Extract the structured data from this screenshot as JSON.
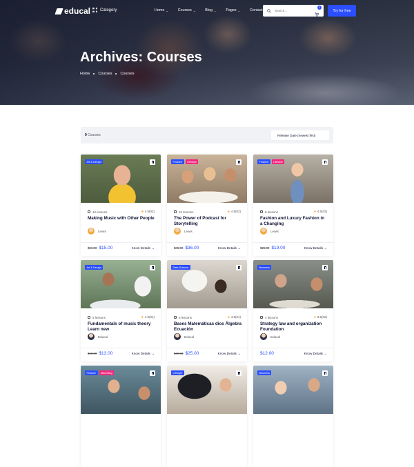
{
  "nav": {
    "logo": "educal",
    "category_label": "Category",
    "menu": [
      "Home",
      "Courses",
      "Blog",
      "Pages",
      "Contact"
    ],
    "menu_dropdowns": [
      true,
      true,
      true,
      true,
      false
    ],
    "search_placeholder": "Search...",
    "cart_count": "0",
    "try_label": "Try for free"
  },
  "hero": {
    "title": "Archives: Courses",
    "breadcrumb": [
      "Home",
      "Courses",
      "Courses"
    ]
  },
  "toolbar": {
    "count": "9",
    "count_label": "Courses",
    "sort_selected": "Release Date (newest first)"
  },
  "colors": {
    "accent": "#2b4eff",
    "tag_blue": "#2b4eff",
    "tag_pink": "#f2277e",
    "tag_purple": "#b128ff",
    "tag_orange": "#ff6b00",
    "star": "#ff9415"
  },
  "cards": [
    {
      "tags": [
        {
          "label": "Art & Design",
          "color": "#2b4eff"
        }
      ],
      "lessons": "12 lessons",
      "rating": "4.5(02)",
      "title": "Making Music with Other People",
      "author": "Lewis",
      "old_price": "$21.00",
      "price": "$15.00",
      "link": "Know Details"
    },
    {
      "tags": [
        {
          "label": "Finance",
          "color": "#2b4eff"
        },
        {
          "label": "Lifestyle",
          "color": "#f2277e"
        }
      ],
      "lessons": "10 lessons",
      "rating": "4.5(02)",
      "title": "The Power of Podcast for Storytelling",
      "author": "Lewis",
      "old_price": "$45.00",
      "price": "$36.00",
      "link": "Know Details"
    },
    {
      "tags": [
        {
          "label": "Finance",
          "color": "#2b4eff"
        },
        {
          "label": "Lifestyle",
          "color": "#f2277e"
        }
      ],
      "lessons": "8 lessons",
      "rating": "4.5(02)",
      "title": "Fashion and Luxury Fashion in a Changing",
      "author": "Lewis",
      "old_price": "$25.00",
      "price": "$19.00",
      "link": "Know Details"
    },
    {
      "tags": [
        {
          "label": "Art & Design",
          "color": "#2b4eff"
        }
      ],
      "lessons": "5 lessons",
      "rating": "4.0(01)",
      "title": "Fundamentals of music theory Learn new",
      "author": "Educal",
      "old_price": "$19.00",
      "price": "$13.00",
      "link": "Know Details"
    },
    {
      "tags": [
        {
          "label": "Data Science",
          "color": "#2b4eff"
        }
      ],
      "lessons": "6 lessons",
      "rating": "4.5(01)",
      "title": "Bases Matemáticas dios Álgebra Ecuación",
      "author": "Educal",
      "old_price": "$39.00",
      "price": "$25.00",
      "link": "Know Details"
    },
    {
      "tags": [
        {
          "label": "Business",
          "color": "#2b4eff"
        }
      ],
      "lessons": "4 lessons",
      "rating": "3.5(02)",
      "title": "Strategy law and organization Foundation",
      "author": "Educal",
      "old_price": "",
      "price": "$12.00",
      "link": "Know Details"
    },
    {
      "tags": [
        {
          "label": "Finance",
          "color": "#2b4eff"
        },
        {
          "label": "Marketing",
          "color": "#f2277e"
        }
      ],
      "lessons": "",
      "rating": "",
      "title": "",
      "author": "",
      "old_price": "",
      "price": "",
      "link": ""
    },
    {
      "tags": [
        {
          "label": "Lifestyle",
          "color": "#2b4eff"
        }
      ],
      "lessons": "",
      "rating": "",
      "title": "",
      "author": "",
      "old_price": "",
      "price": "",
      "link": ""
    },
    {
      "tags": [
        {
          "label": "Business",
          "color": "#2b4eff"
        }
      ],
      "lessons": "",
      "rating": "",
      "title": "",
      "author": "",
      "old_price": "",
      "price": "",
      "link": ""
    }
  ]
}
